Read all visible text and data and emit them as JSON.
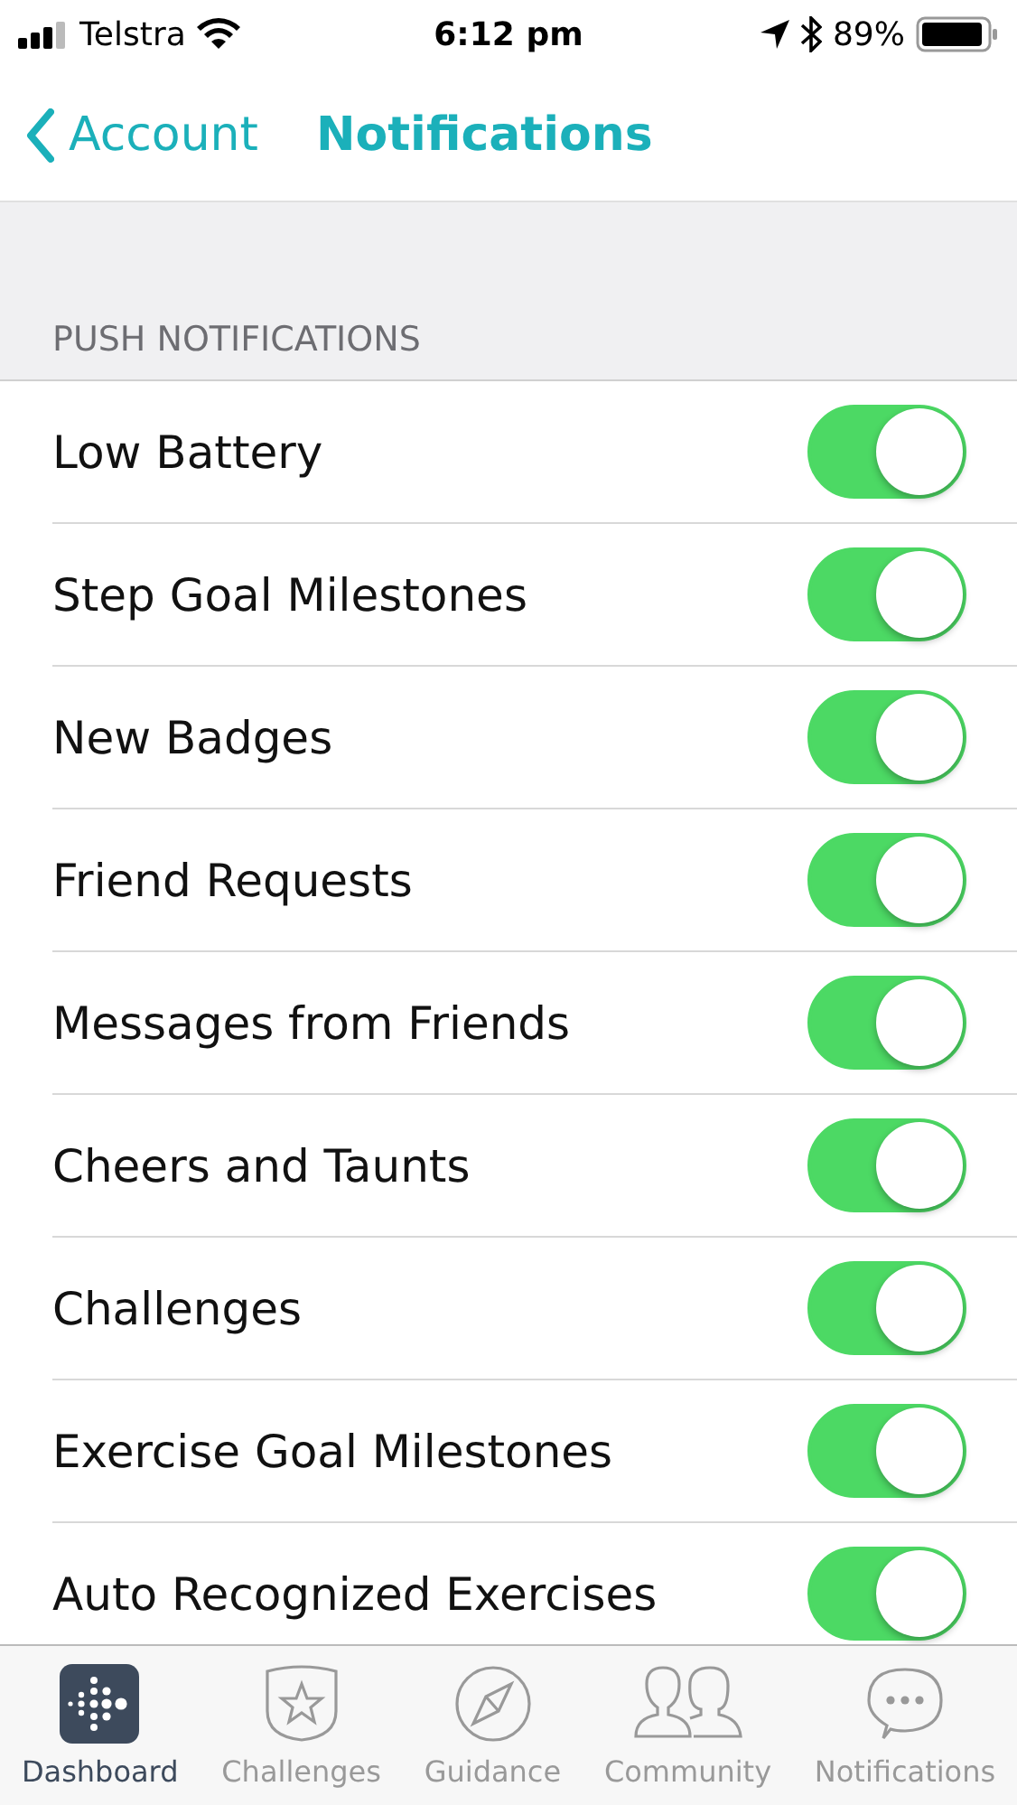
{
  "status_bar": {
    "carrier": "Telstra",
    "time": "6:12 pm",
    "battery": "89%"
  },
  "nav": {
    "back": "Account",
    "title": "Notifications"
  },
  "section": "PUSH NOTIFICATIONS",
  "settings": [
    {
      "label": "Low Battery",
      "on": true
    },
    {
      "label": "Step Goal Milestones",
      "on": true
    },
    {
      "label": "New Badges",
      "on": true
    },
    {
      "label": "Friend Requests",
      "on": true
    },
    {
      "label": "Messages from Friends",
      "on": true
    },
    {
      "label": "Cheers and Taunts",
      "on": true
    },
    {
      "label": "Challenges",
      "on": true
    },
    {
      "label": "Exercise Goal Milestones",
      "on": true
    },
    {
      "label": "Auto Recognized Exercises",
      "on": true
    }
  ],
  "tabs": [
    {
      "label": "Dashboard",
      "selected": true
    },
    {
      "label": "Challenges",
      "selected": false
    },
    {
      "label": "Guidance",
      "selected": false
    },
    {
      "label": "Community",
      "selected": false
    },
    {
      "label": "Notifications",
      "selected": false
    }
  ]
}
